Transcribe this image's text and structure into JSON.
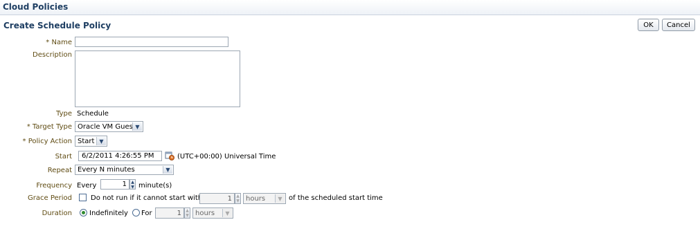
{
  "header": {
    "title": "Cloud Policies"
  },
  "page": {
    "title": "Create Schedule Policy"
  },
  "buttons": {
    "ok": "OK",
    "cancel": "Cancel"
  },
  "form": {
    "name": {
      "label": "Name",
      "required": "*",
      "value": ""
    },
    "description": {
      "label": "Description",
      "value": ""
    },
    "type": {
      "label": "Type",
      "value": "Schedule"
    },
    "target_type": {
      "label": "Target Type",
      "required": "*",
      "value": "Oracle VM Guest"
    },
    "policy_action": {
      "label": "Policy Action",
      "required": "*",
      "value": "Start"
    },
    "start": {
      "label": "Start",
      "value": "6/2/2011 4:26:55 PM",
      "timezone": "(UTC+00:00) Universal Time",
      "icon": "calendar-clock-icon"
    },
    "repeat": {
      "label": "Repeat",
      "value": "Every N minutes"
    },
    "frequency": {
      "label": "Frequency",
      "prefix": "Every",
      "value": "1",
      "unit": "minute(s)"
    },
    "grace_period": {
      "label": "Grace Period",
      "checkbox_label": "Do not run if it cannot start within",
      "checked": false,
      "value": "1",
      "unit": "hours",
      "suffix": "of the scheduled start time"
    },
    "duration": {
      "label": "Duration",
      "option_indefinitely": "Indefinitely",
      "option_for": "For",
      "selected": "Indefinitely",
      "value": "1",
      "unit": "hours"
    }
  }
}
